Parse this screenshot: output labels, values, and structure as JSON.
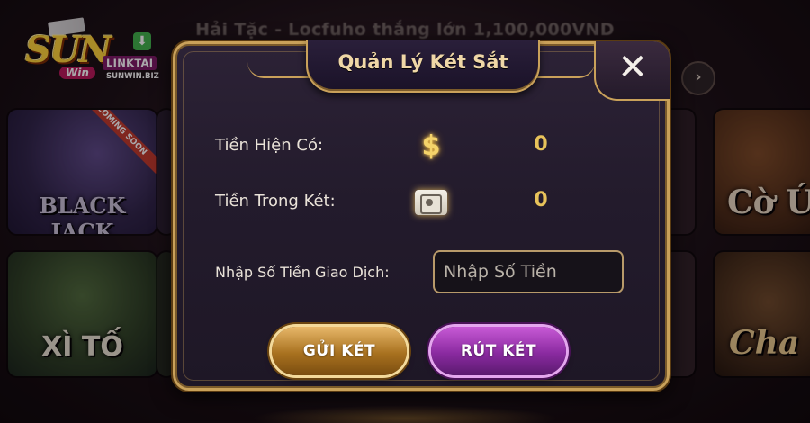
{
  "ticker": "Hải Tặc - Locfuho thắng lớn 1,100,000VND",
  "logo": {
    "brand": "SUN",
    "tagline": "Win",
    "link_label": "LINKTAI",
    "domain": "SUNWIN.BIZ"
  },
  "nav": {
    "next_icon": "chevron-right-icon",
    "next_glyph": "›"
  },
  "tiles": {
    "blackjack": {
      "label": "BLACK JACK",
      "badge": "COMING SOON"
    },
    "xito": {
      "label": "XÌ TỐ"
    },
    "coup": {
      "label": "Cờ Ú"
    },
    "chan": {
      "label": "Cha"
    }
  },
  "modal": {
    "title": "Quản Lý Két Sắt",
    "close_glyph": "✕",
    "balance": {
      "label": "Tiền Hiện Có:",
      "icon": "dollar-icon",
      "value": "0"
    },
    "safe": {
      "label": "Tiền Trong Két:",
      "icon": "safe-icon",
      "value": "0"
    },
    "amount": {
      "label": "Nhập Số Tiền Giao Dịch:",
      "placeholder": "Nhập Số Tiền",
      "value": ""
    },
    "deposit_label": "GỬI KÉT",
    "withdraw_label": "RÚT KÉT"
  },
  "colors": {
    "accent_gold": "#c9a15a",
    "value_gold": "#e8c35a",
    "deposit_button": "#a8711f",
    "withdraw_button": "#8a2aa0"
  }
}
